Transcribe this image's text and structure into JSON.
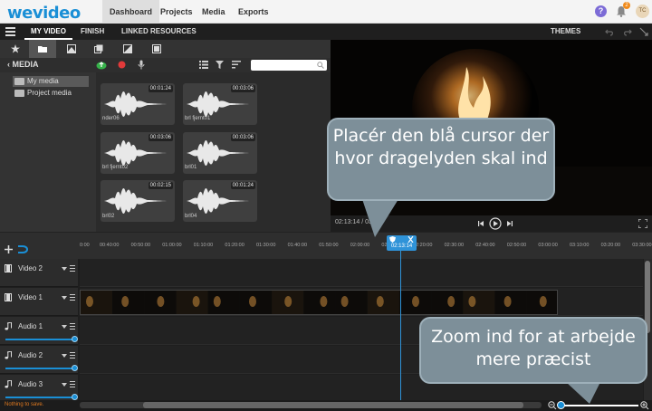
{
  "topnav": {
    "logo": "wevideo",
    "links": [
      "Dashboard",
      "Projects",
      "Media",
      "Exports"
    ],
    "notification_count": "2",
    "avatar_initials": "TC",
    "help": "?"
  },
  "secbar": {
    "tabs": [
      "MY VIDEO",
      "FINISH",
      "LINKED RESOURCES"
    ],
    "themes": "THEMES"
  },
  "media": {
    "label": "MEDIA",
    "folders": [
      "My media",
      "Project media"
    ],
    "cards": [
      {
        "duration": "00:01:24",
        "name": "nder06"
      },
      {
        "duration": "00:03:06",
        "name": "brl fjernt01"
      },
      {
        "duration": "00:03:06",
        "name": "brl fjernt02"
      },
      {
        "duration": "00:03:06",
        "name": "brl01"
      },
      {
        "duration": "00:02:15",
        "name": "brl02"
      },
      {
        "duration": "00:01:24",
        "name": "brl04"
      }
    ]
  },
  "preview": {
    "timecode": "02:13:14 / 03:02"
  },
  "timeline": {
    "ticks": [
      "0:00",
      "00:40:00",
      "00:50:00",
      "01:00:00",
      "01:10:00",
      "01:20:00",
      "01:30:00",
      "01:40:00",
      "01:50:00",
      "02:00:00",
      "02:10:00",
      "02:20:00",
      "02:30:00",
      "02:40:00",
      "02:50:00",
      "03:00:00",
      "03:10:00",
      "03:20:00",
      "03:30:00"
    ],
    "playhead_time": "02:13:14",
    "tracks": [
      "Video 2",
      "Video 1",
      "Audio 1",
      "Audio 2",
      "Audio 3"
    ]
  },
  "status": "Nothing to save.",
  "callouts": {
    "cursor": "Placér den blå cursor der hvor dragelyden skal ind",
    "zoom": "Zoom ind for at arbejde mere præcist"
  },
  "colors": {
    "accent": "#1a8fd6",
    "playhead": "#2f93d8",
    "callout": "#7d8f99",
    "warning": "#e07a20"
  }
}
